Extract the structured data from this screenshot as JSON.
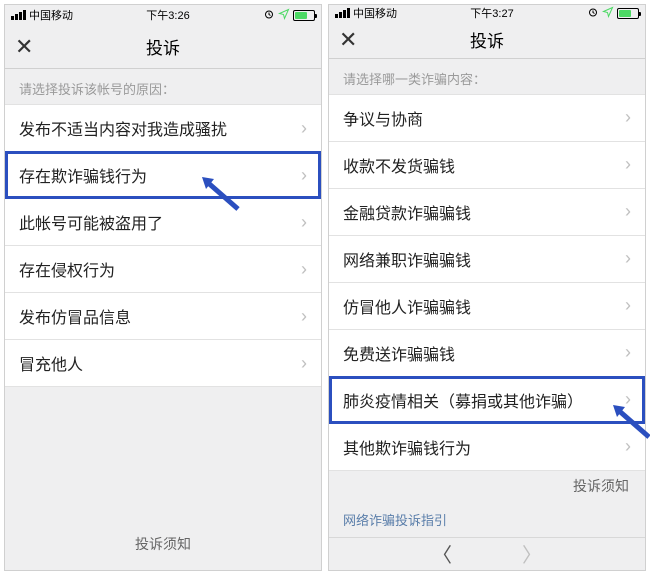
{
  "left": {
    "status": {
      "carrier": "中国移动",
      "time": "下午3:26"
    },
    "nav": {
      "close": "✕",
      "title": "投诉"
    },
    "hint": "请选择投诉该帐号的原因：",
    "items": [
      {
        "label": "发布不适当内容对我造成骚扰",
        "highlight": false
      },
      {
        "label": "存在欺诈骗钱行为",
        "highlight": true
      },
      {
        "label": "此帐号可能被盗用了",
        "highlight": false
      },
      {
        "label": "存在侵权行为",
        "highlight": false
      },
      {
        "label": "发布仿冒品信息",
        "highlight": false
      },
      {
        "label": "冒充他人",
        "highlight": false
      }
    ],
    "footer": "投诉须知"
  },
  "right": {
    "status": {
      "carrier": "中国移动",
      "time": "下午3:27"
    },
    "nav": {
      "close": "✕",
      "title": "投诉"
    },
    "hint": "请选择哪一类诈骗内容：",
    "items": [
      {
        "label": "争议与协商",
        "highlight": false
      },
      {
        "label": "收款不发货骗钱",
        "highlight": false
      },
      {
        "label": "金融贷款诈骗骗钱",
        "highlight": false
      },
      {
        "label": "网络兼职诈骗骗钱",
        "highlight": false
      },
      {
        "label": "仿冒他人诈骗骗钱",
        "highlight": false
      },
      {
        "label": "免费送诈骗骗钱",
        "highlight": false
      },
      {
        "label": "肺炎疫情相关（募捐或其他诈骗）",
        "highlight": true
      },
      {
        "label": "其他欺诈骗钱行为",
        "highlight": false
      }
    ],
    "footer": "投诉须知",
    "guide": "网络诈骗投诉指引"
  }
}
